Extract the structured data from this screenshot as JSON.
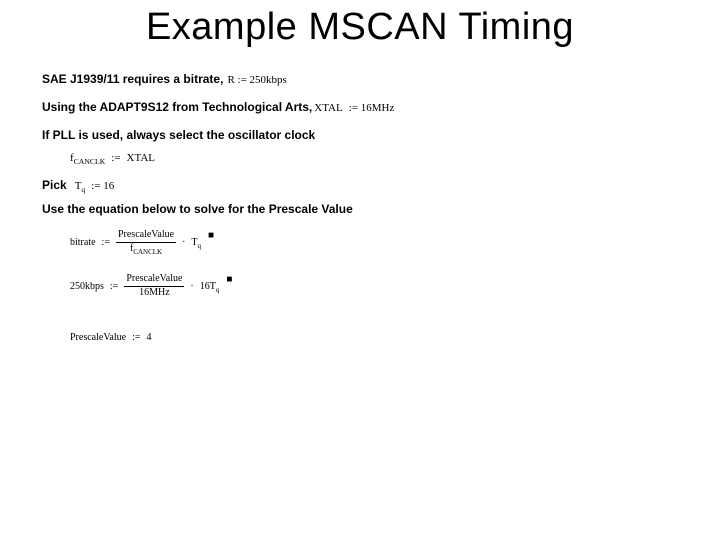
{
  "title": "Example MSCAN Timing",
  "line1": {
    "lead": "SAE J1939/11 requires  a bitrate,",
    "expr": "R := 250kbps"
  },
  "line2": {
    "lead": "Using the ADAPT9S12 from Technological Arts,",
    "expr_lhs": "XTAL",
    "expr_rhs": ":= 16MHz"
  },
  "line3": {
    "lead": "If PLL is used, always select the oscillator clock"
  },
  "line3eq": {
    "lhs_base": "f",
    "lhs_sub": "CANCLK",
    "assign": ":=",
    "rhs": "XTAL"
  },
  "line4": {
    "lead": "Pick",
    "expr_lhs": "T",
    "expr_sub": "q",
    "expr_rhs": ":= 16"
  },
  "line5": {
    "lead": "Use the equation below to solve for the Prescale Value"
  },
  "eq1": {
    "lhs": "bitrate",
    "assign": ":=",
    "num": "PrescaleValue",
    "den_base": "f",
    "den_sub": "CANCLK",
    "mult": "·",
    "rhs_base": "T",
    "rhs_sub": "q"
  },
  "eq2": {
    "lhs": "250kbps",
    "assign": ":=",
    "num": "PrescaleValue",
    "den": "16MHz",
    "mult": "·",
    "rhs": "16T",
    "rhs_sub": "q"
  },
  "result": {
    "lhs": "PrescaleValue",
    "assign": ":=",
    "rhs": "4"
  }
}
